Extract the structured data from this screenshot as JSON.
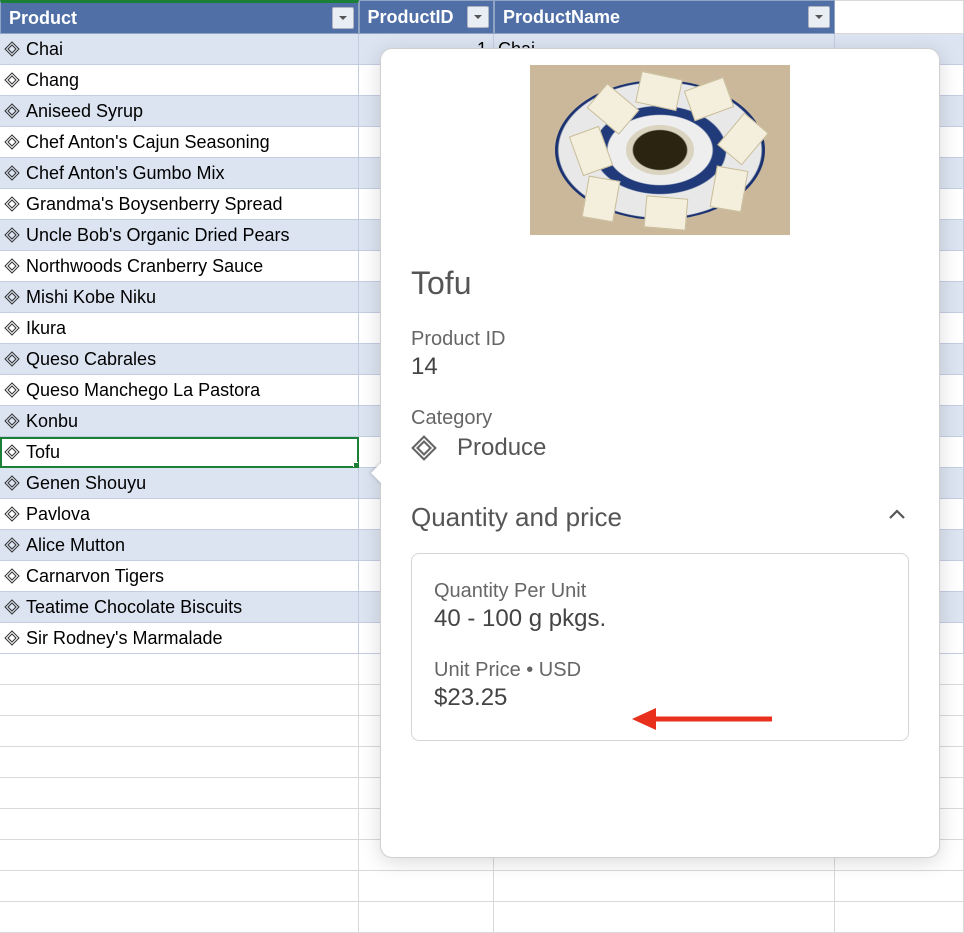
{
  "columns": {
    "product": "Product",
    "productId": "ProductID",
    "productName": "ProductName"
  },
  "rows": [
    {
      "product": "Chai",
      "id": "1",
      "name": "Chai",
      "alt": true
    },
    {
      "product": "Chang",
      "alt": false
    },
    {
      "product": "Aniseed Syrup",
      "alt": true
    },
    {
      "product": "Chef Anton's Cajun Seasoning",
      "alt": false
    },
    {
      "product": "Chef Anton's Gumbo Mix",
      "alt": true
    },
    {
      "product": "Grandma's Boysenberry Spread",
      "alt": false
    },
    {
      "product": "Uncle Bob's Organic Dried Pears",
      "alt": true
    },
    {
      "product": "Northwoods Cranberry Sauce",
      "alt": false
    },
    {
      "product": "Mishi Kobe Niku",
      "alt": true
    },
    {
      "product": "Ikura",
      "alt": false
    },
    {
      "product": "Queso Cabrales",
      "alt": true
    },
    {
      "product": "Queso Manchego La Pastora",
      "alt": false
    },
    {
      "product": "Konbu",
      "alt": true
    },
    {
      "product": "Tofu",
      "alt": false,
      "selected": true
    },
    {
      "product": "Genen Shouyu",
      "alt": true
    },
    {
      "product": "Pavlova",
      "alt": false
    },
    {
      "product": "Alice Mutton",
      "alt": true
    },
    {
      "product": "Carnarvon Tigers",
      "alt": false
    },
    {
      "product": "Teatime Chocolate Biscuits",
      "alt": true
    },
    {
      "product": "Sir Rodney's Marmalade",
      "alt": false
    }
  ],
  "card": {
    "title": "Tofu",
    "productIdLabel": "Product ID",
    "productId": "14",
    "categoryLabel": "Category",
    "category": "Produce",
    "sectionTitle": "Quantity and price",
    "qtyLabel": "Quantity Per Unit",
    "qtyValue": "40 - 100 g pkgs.",
    "priceLabel": "Unit Price • USD",
    "priceValue": "$23.25"
  }
}
